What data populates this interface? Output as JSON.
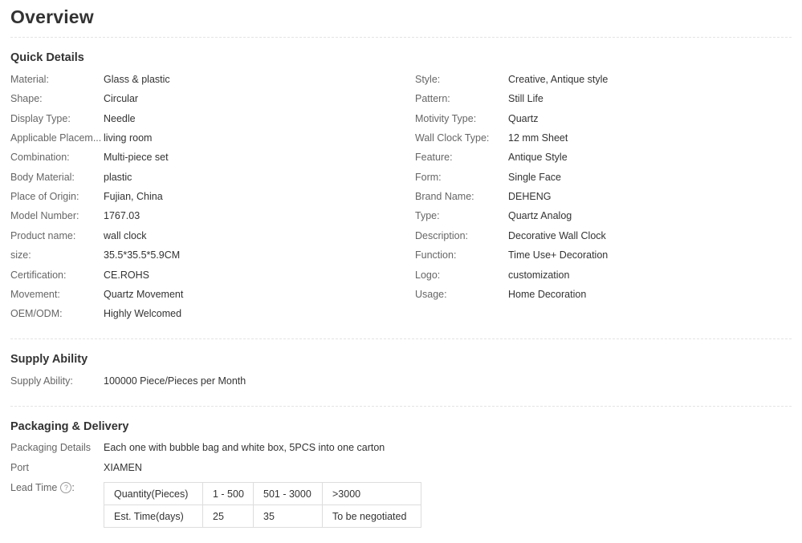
{
  "page_title": "Overview",
  "quick_details": {
    "title": "Quick Details",
    "left": [
      {
        "label": "Material:",
        "value": "Glass & plastic"
      },
      {
        "label": "Shape:",
        "value": "Circular"
      },
      {
        "label": "Display Type:",
        "value": "Needle"
      },
      {
        "label": "Applicable Placem...",
        "value": "living room"
      },
      {
        "label": "Combination:",
        "value": "Multi-piece set"
      },
      {
        "label": "Body Material:",
        "value": "plastic"
      },
      {
        "label": "Place of Origin:",
        "value": "Fujian, China"
      },
      {
        "label": "Model Number:",
        "value": "1767.03"
      },
      {
        "label": "Product name:",
        "value": "wall clock"
      },
      {
        "label": "size:",
        "value": "35.5*35.5*5.9CM"
      },
      {
        "label": "Certification:",
        "value": "CE.ROHS"
      },
      {
        "label": "Movement:",
        "value": "Quartz Movement"
      },
      {
        "label": "OEM/ODM:",
        "value": "Highly Welcomed"
      }
    ],
    "right": [
      {
        "label": "Style:",
        "value": "Creative, Antique style"
      },
      {
        "label": "Pattern:",
        "value": "Still Life"
      },
      {
        "label": "Motivity Type:",
        "value": "Quartz"
      },
      {
        "label": "Wall Clock Type:",
        "value": "12 mm Sheet"
      },
      {
        "label": "Feature:",
        "value": "Antique Style"
      },
      {
        "label": "Form:",
        "value": "Single Face"
      },
      {
        "label": "Brand Name:",
        "value": "DEHENG"
      },
      {
        "label": "Type:",
        "value": "Quartz Analog"
      },
      {
        "label": "Description:",
        "value": "Decorative Wall Clock"
      },
      {
        "label": "Function:",
        "value": "Time Use+ Decoration"
      },
      {
        "label": "Logo:",
        "value": "customization"
      },
      {
        "label": "Usage:",
        "value": "Home Decoration"
      }
    ]
  },
  "supply_ability": {
    "title": "Supply Ability",
    "label": "Supply Ability:",
    "value": "100000 Piece/Pieces per Month"
  },
  "packaging": {
    "title": "Packaging & Delivery",
    "details_label": "Packaging Details",
    "details_value": "Each one with bubble bag and white box, 5PCS into one carton",
    "port_label": "Port",
    "port_value": "XIAMEN",
    "lead_time_label": "Lead Time",
    "help_icon": "question-circle-icon",
    "help_glyph": "?",
    "lead_table": [
      [
        "Quantity(Pieces)",
        "1 - 500",
        "501 - 3000",
        ">3000"
      ],
      [
        "Est. Time(days)",
        "25",
        "35",
        "To be negotiated"
      ]
    ]
  }
}
